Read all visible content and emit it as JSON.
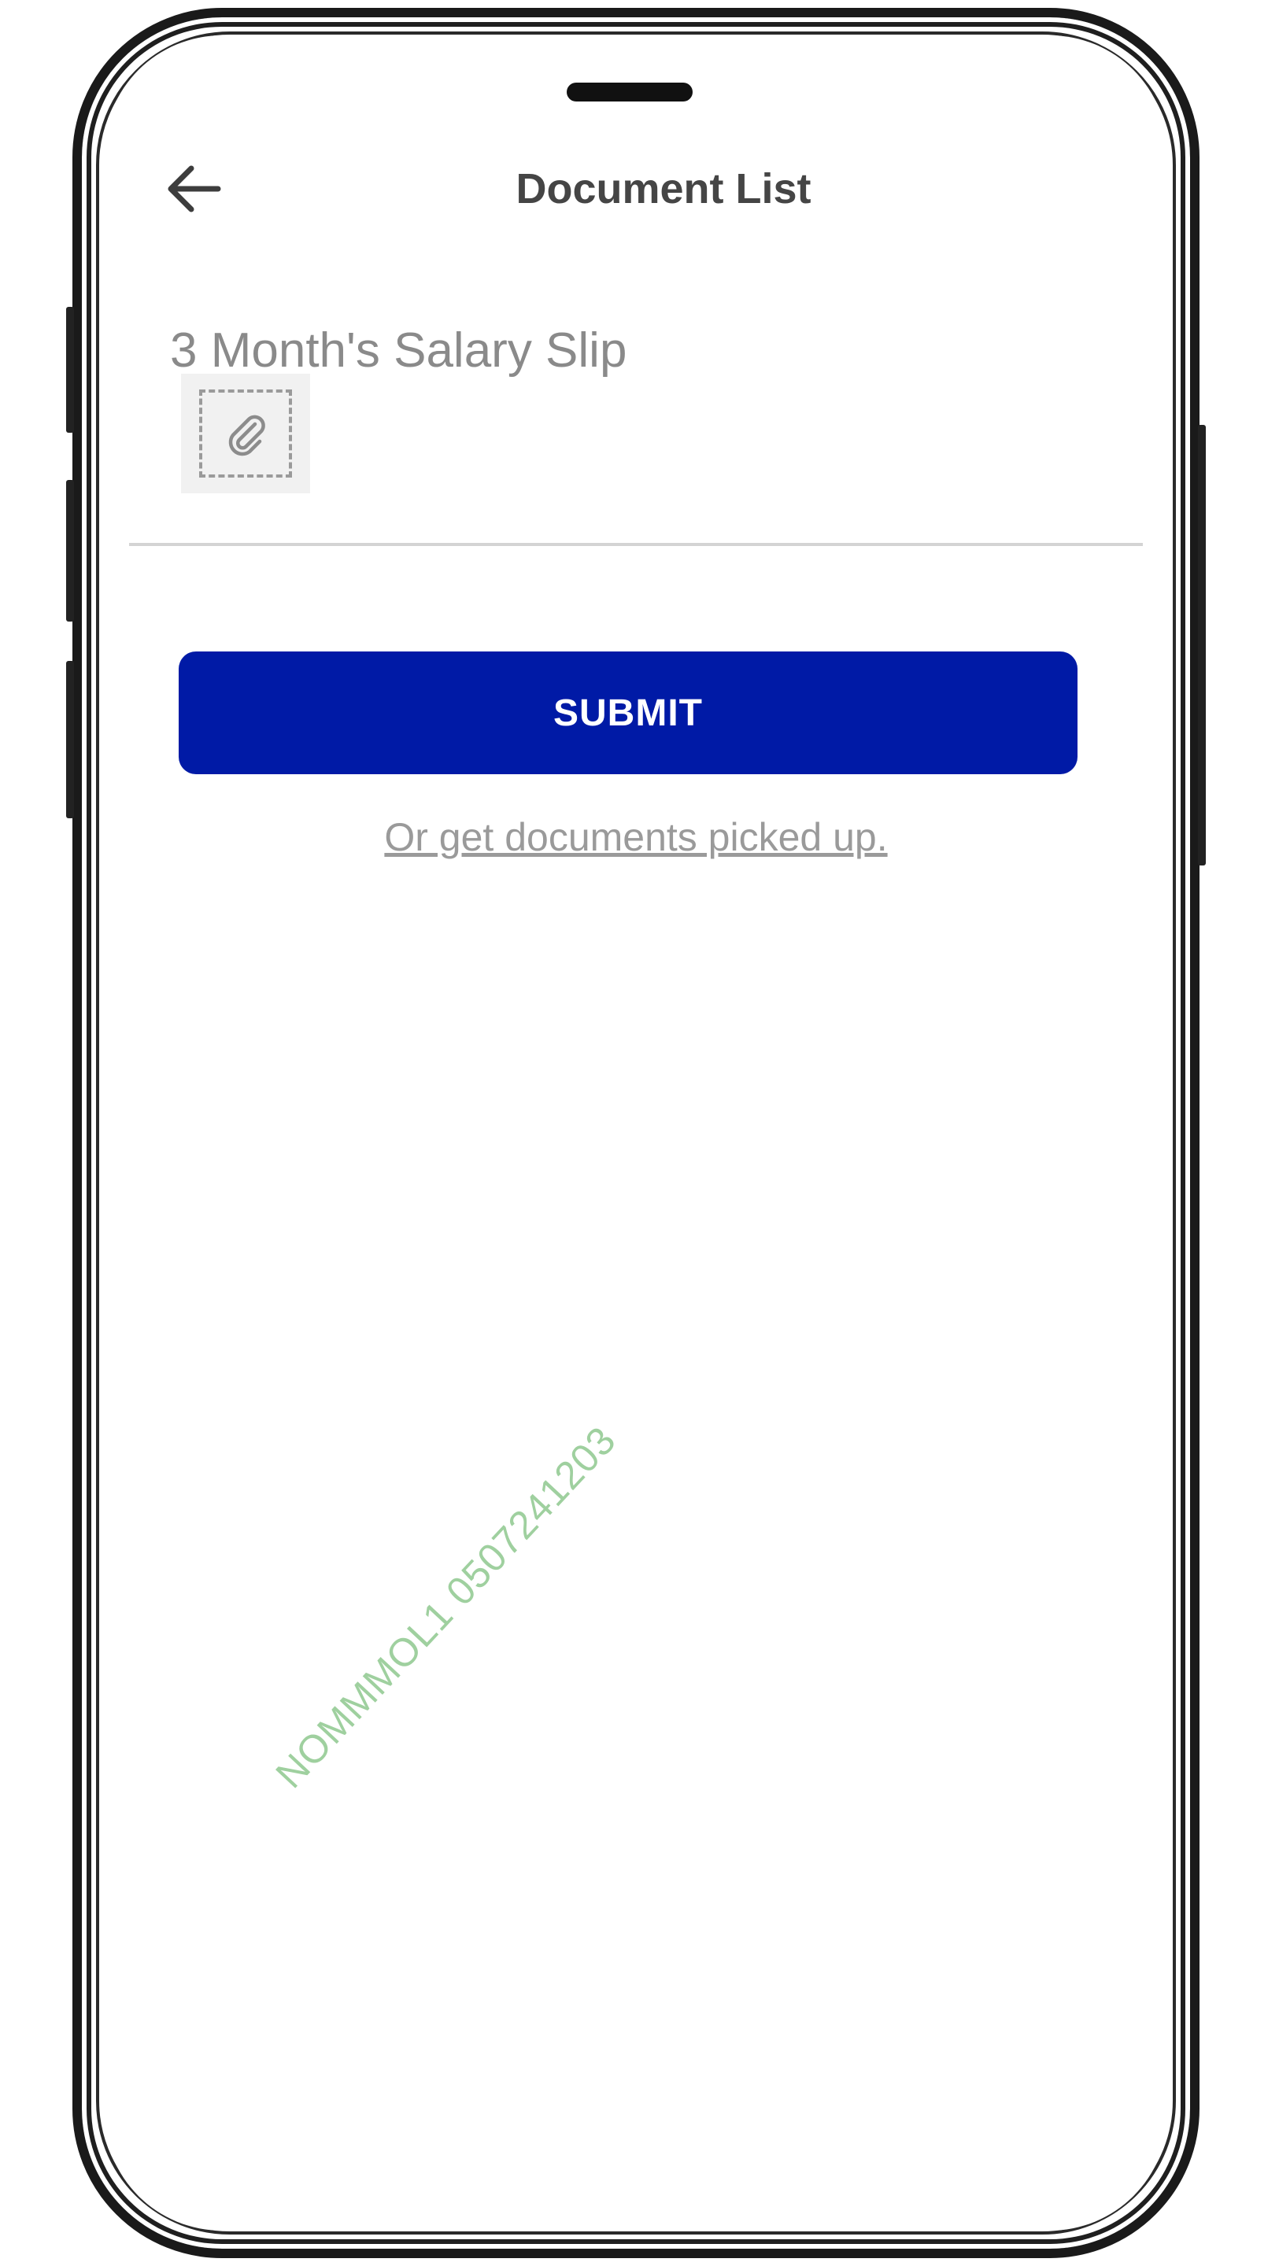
{
  "header": {
    "title": "Document List",
    "back_icon": "arrow-left-icon"
  },
  "documents": [
    {
      "label": "3 Month's Salary Slip",
      "attach_icon": "paperclip-icon"
    }
  ],
  "actions": {
    "submit_label": "SUBMIT",
    "pickup_link": "Or get documents picked up."
  },
  "watermark": "NOMMMOL1 0507241203",
  "colors": {
    "primary": "#001aa6",
    "title_text": "#454545",
    "label_text": "#8a8a8a",
    "watermark": "#9fd09f"
  }
}
